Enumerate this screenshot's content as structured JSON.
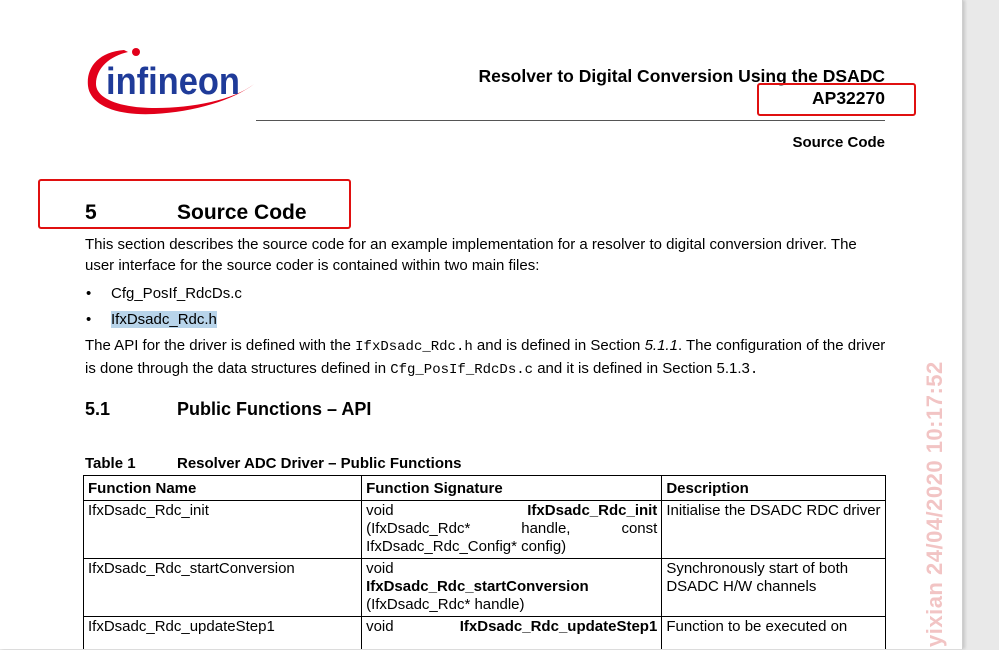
{
  "brand": {
    "logo_text": "infineon",
    "logo_color": "#1f3b99",
    "swoosh_color": "#e2001a"
  },
  "header": {
    "doc_title": "Resolver to Digital Conversion Using the DSADC",
    "doc_id": "AP32270",
    "running_head": "Source Code"
  },
  "section": {
    "number": "5",
    "title": "Source Code",
    "intro": "This section describes the source code for an example implementation for a resolver to digital conversion driver. The user interface for the source coder is contained within two main files:",
    "files": [
      "Cfg_PosIf_RdcDs.c",
      "IfxDsadc_Rdc.h"
    ],
    "api_para": {
      "t1": "The API for the driver is defined with the ",
      "code1": "IfxDsadc_Rdc.h",
      "t2": " and is defined in Section ",
      "ref1": "5.1.1",
      "t3": ". The configuration of the driver is done through the data structures defined in ",
      "code2": "Cfg_PosIf_RdcDs.c",
      "t4": " and it is defined in Section 5.1.3",
      "t5": "."
    }
  },
  "subsection": {
    "number": "5.1",
    "title": "Public Functions – API"
  },
  "table": {
    "caption_number": "Table 1",
    "caption_title": "Resolver ADC Driver – Public Functions",
    "headers": [
      "Function Name",
      "Function Signature",
      "Description"
    ],
    "rows": [
      {
        "name": "IfxDsadc_Rdc_init",
        "sig_type": "void",
        "sig_func": "IfxDsadc_Rdc_init",
        "sig_args_a": "(IfxDsadc_Rdc*",
        "sig_args_b": "handle,",
        "sig_args_c": "const",
        "sig_args_d": "IfxDsadc_Rdc_Config* config)",
        "desc": "Initialise the DSADC RDC driver"
      },
      {
        "name": "IfxDsadc_Rdc_startConversion",
        "sig_type": "void",
        "sig_func": "IfxDsadc_Rdc_startConversion",
        "sig_args": "(IfxDsadc_Rdc* handle)",
        "desc": "Synchronously start of both DSADC H/W channels"
      },
      {
        "name": "IfxDsadc_Rdc_updateStep1",
        "sig_type": "void",
        "sig_func": "IfxDsadc_Rdc_updateStep1",
        "desc": "Function to be executed on"
      }
    ]
  },
  "watermark": "yixian 24/04/2020 10:17:52",
  "colors": {
    "annotation_red": "#e01010",
    "selection_highlight": "#b8d4ea",
    "watermark": "#f2c4c4"
  }
}
